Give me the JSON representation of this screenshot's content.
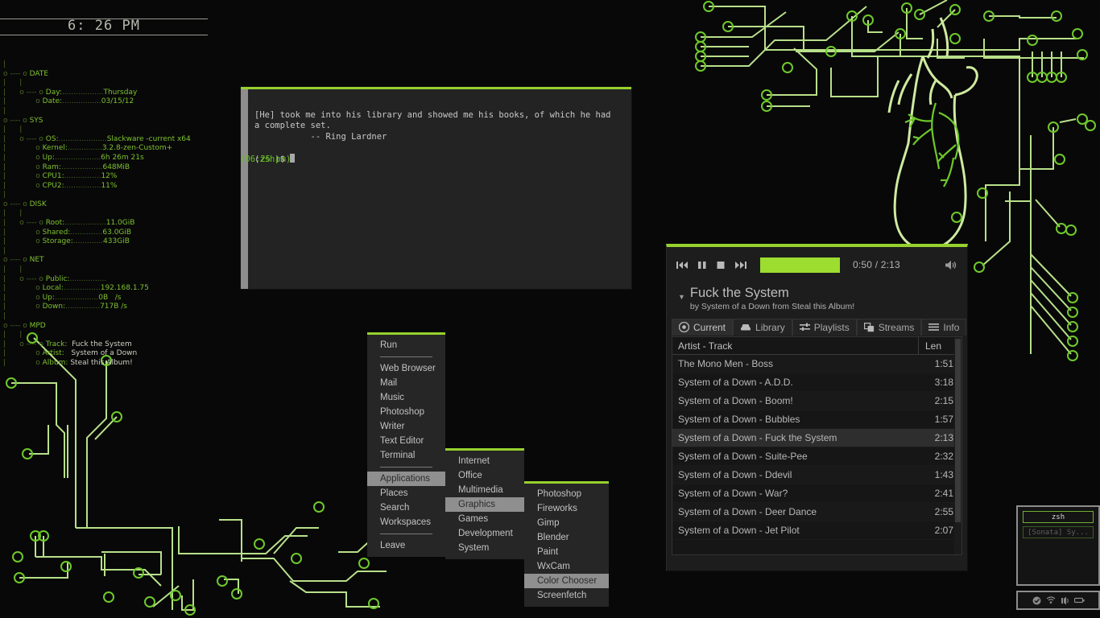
{
  "conky": {
    "clock": "6: 26 PM",
    "sections": [
      {
        "name": "DATE",
        "entries": [
          {
            "key": "Day:",
            "dots": "..................",
            "value": "Thursday"
          },
          {
            "key": "Date:",
            "dots": ".................",
            "value": "03/15/12"
          }
        ]
      },
      {
        "name": "SYS",
        "entries": [
          {
            "key": "OS:",
            "dots": ".....................",
            "value": "Slackware -current x64"
          },
          {
            "key": "Kernel:",
            "dots": "...............",
            "value": "3.2.8-zen-Custom+"
          },
          {
            "key": "Up:",
            "dots": "....................",
            "value": "6h 26m 21s"
          },
          {
            "key": "Ram:",
            "dots": "..................",
            "value": "648MiB"
          },
          {
            "key": "CPU1:",
            "dots": "................",
            "value": "12%"
          },
          {
            "key": "CPU2:",
            "dots": "................",
            "value": "11%"
          }
        ]
      },
      {
        "name": "DISK",
        "entries": [
          {
            "key": "Root:",
            "dots": "..................",
            "value": "11.0GiB"
          },
          {
            "key": "Shared:",
            "dots": "..............",
            "value": "63.0GiB"
          },
          {
            "key": "Storage:",
            "dots": ".............",
            "value": "433GiB"
          }
        ]
      },
      {
        "name": "NET",
        "entries": [
          {
            "key": "Public:",
            "dots": "................",
            "value": ""
          },
          {
            "key": "Local:",
            "dots": "................",
            "value": "192.168.1.75"
          },
          {
            "key": "Up:",
            "dots": "...................",
            "value": "0B   /s"
          },
          {
            "key": "Down:",
            "dots": "...............",
            "value": "717B /s"
          }
        ]
      },
      {
        "name": "MPD",
        "entries": [
          {
            "key": "Track:",
            "dots": "  ",
            "value": "Fuck the System"
          },
          {
            "key": "Artist:",
            "dots": "   ",
            "value": "System of a Down"
          },
          {
            "key": "Album:",
            "dots": " ",
            "value": "Steal this Album!"
          }
        ]
      }
    ]
  },
  "terminal": {
    "quote_line1": "[He] took me into his library and showed me his books, of which he had",
    "quote_line2": "a complete set.",
    "attribution": "           -- Ring Lardner",
    "prompt_open": "(",
    "prompt_shell": "zsh",
    "prompt_close": ")$ ",
    "timestamp": "(06:25 pm)"
  },
  "menu": {
    "root": [
      {
        "label": "Run",
        "selected": false
      },
      {
        "sep": true
      },
      {
        "label": "Web Browser",
        "selected": false
      },
      {
        "label": "Mail",
        "selected": false
      },
      {
        "label": "Music",
        "selected": false
      },
      {
        "label": "Photoshop",
        "selected": false
      },
      {
        "label": "Writer",
        "selected": false
      },
      {
        "label": "Text Editor",
        "selected": false
      },
      {
        "label": "Terminal",
        "selected": false
      },
      {
        "sep": true
      },
      {
        "label": "Applications",
        "selected": true
      },
      {
        "label": "Places",
        "selected": false
      },
      {
        "label": "Search",
        "selected": false
      },
      {
        "label": "Workspaces",
        "selected": false
      },
      {
        "sep": true
      },
      {
        "label": "Leave",
        "selected": false
      }
    ],
    "applications": [
      {
        "label": "Internet",
        "selected": false
      },
      {
        "label": "Office",
        "selected": false
      },
      {
        "label": "Multimedia",
        "selected": false
      },
      {
        "label": "Graphics",
        "selected": true
      },
      {
        "label": "Games",
        "selected": false
      },
      {
        "label": "Development",
        "selected": false
      },
      {
        "label": "System",
        "selected": false
      }
    ],
    "graphics": [
      {
        "label": "Photoshop",
        "selected": false
      },
      {
        "label": "Fireworks",
        "selected": false
      },
      {
        "label": "Gimp",
        "selected": false
      },
      {
        "label": "Blender",
        "selected": false
      },
      {
        "label": "Paint",
        "selected": false
      },
      {
        "label": "WxCam",
        "selected": false
      },
      {
        "label": "Color Chooser",
        "selected": true
      },
      {
        "label": "Screenfetch",
        "selected": false
      }
    ]
  },
  "player": {
    "controls": [
      {
        "name": "previous-button",
        "icon": "skip-back-icon"
      },
      {
        "name": "pause-button",
        "icon": "pause-icon"
      },
      {
        "name": "stop-button",
        "icon": "stop-icon"
      },
      {
        "name": "next-button",
        "icon": "skip-forward-icon"
      }
    ],
    "seek_percent": 38,
    "time": "0:50 / 2:13",
    "volume_icon": "speaker-icon",
    "now_playing_title": "Fuck the System",
    "now_playing_sub": "by System of a Down from Steal this Album!",
    "tabs": [
      {
        "label": "Current",
        "icon": "record-icon",
        "active": true
      },
      {
        "label": "Library",
        "icon": "drive-icon",
        "active": false
      },
      {
        "label": "Playlists",
        "icon": "sliders-icon",
        "active": false
      },
      {
        "label": "Streams",
        "icon": "windows-icon",
        "active": false
      },
      {
        "label": "Info",
        "icon": "lines-icon",
        "active": false
      }
    ],
    "playlist_headers": {
      "track": "Artist - Track",
      "length": "Len"
    },
    "playlist": [
      {
        "track": "The Mono Men - Boss",
        "len": "1:51",
        "selected": false
      },
      {
        "track": "System of a Down - A.D.D.",
        "len": "3:18",
        "selected": false
      },
      {
        "track": "System of a Down - Boom!",
        "len": "2:15",
        "selected": false
      },
      {
        "track": "System of a Down - Bubbles",
        "len": "1:57",
        "selected": false
      },
      {
        "track": "System of a Down - Fuck the System",
        "len": "2:13",
        "selected": true
      },
      {
        "track": "System of a Down - Suite-Pee",
        "len": "2:32",
        "selected": false
      },
      {
        "track": "System of a Down - Ddevil",
        "len": "1:43",
        "selected": false
      },
      {
        "track": "System of a Down - War?",
        "len": "2:41",
        "selected": false
      },
      {
        "track": "System of a Down - Deer Dance",
        "len": "2:55",
        "selected": false
      },
      {
        "track": "System of a Down - Jet Pilot",
        "len": "2:07",
        "selected": false
      }
    ]
  },
  "panel": {
    "tasks": [
      {
        "label": "zsh",
        "active": true
      },
      {
        "label": "[Sonata] Sy...",
        "active": false
      }
    ],
    "tray": [
      {
        "name": "checkmark-icon"
      },
      {
        "name": "wifi-icon"
      },
      {
        "name": "volume-icon"
      },
      {
        "name": "battery-icon"
      }
    ]
  },
  "colors": {
    "accent_green": "#96d12e",
    "conky_green": "#7ec12f",
    "background": "#080808",
    "window_bg": "#232323",
    "menu_bg": "#262626",
    "selection": "#8f8f8f"
  }
}
